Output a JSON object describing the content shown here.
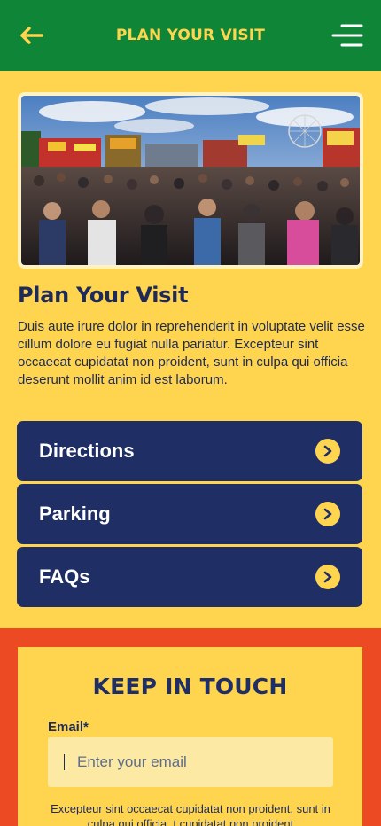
{
  "header": {
    "title": "PLAN YOUR VISIT",
    "back_icon": "arrow-left-icon",
    "menu_icon": "hamburger-menu-icon",
    "background": "#0E8537",
    "accent": "#FFD54F"
  },
  "hero": {
    "image": "fairground-crowd-photo"
  },
  "main": {
    "title": "Plan Your Visit",
    "intro": "Duis aute irure dolor in reprehenderit in voluptate velit esse cillum dolore eu fugiat nulla pariatur. Excepteur sint occaecat cupidatat non proident, sunt in culpa qui officia deserunt mollit anim id est laborum.",
    "links": [
      {
        "label": "Directions",
        "icon": "chevron-right-circle-icon"
      },
      {
        "label": "Parking",
        "icon": "chevron-right-circle-icon"
      },
      {
        "label": "FAQs",
        "icon": "chevron-right-circle-icon"
      }
    ]
  },
  "newsletter": {
    "title": "KEEP IN TOUCH",
    "email_label": "Email*",
    "email_placeholder": "Enter your email",
    "email_value": "",
    "fine_print": "Excepteur sint occaecat cupidatat non proident, sunt in culpa qui officia, t cupidatat non proident"
  },
  "colors": {
    "page_background": "#FFD54F",
    "button_background": "#1F2F66",
    "footer_background": "#EC4A22"
  }
}
